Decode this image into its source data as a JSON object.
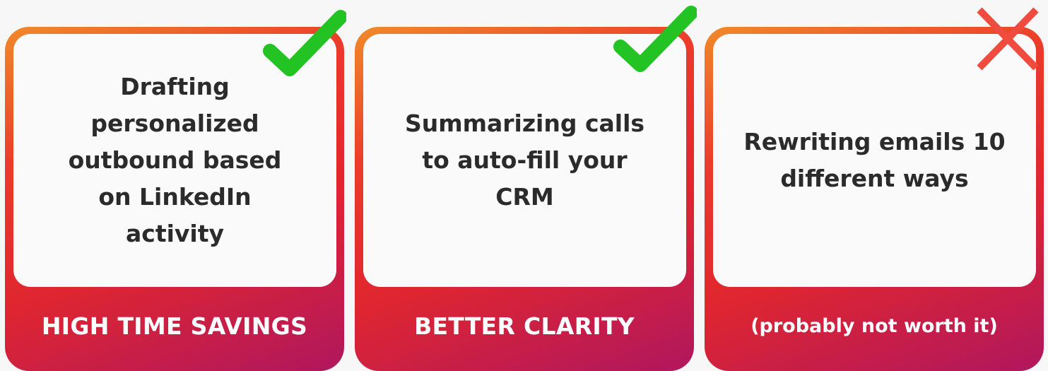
{
  "cards": [
    {
      "text": "Drafting personalized outbound based on LinkedIn activity",
      "label": "HIGH TIME SAVINGS",
      "mark": "check-icon"
    },
    {
      "text": "Summarizing calls to auto-fill your CRM",
      "label": "BETTER CLARITY",
      "mark": "check-icon"
    },
    {
      "text": "Rewriting emails 10 different ways",
      "label": "(probably not worth it)",
      "mark": "cross-icon"
    }
  ],
  "colors": {
    "check": "#22c322",
    "cross": "#ef4b3f",
    "gradient_start": "#f08a2a",
    "gradient_mid": "#e0262f",
    "gradient_end": "#b0175e",
    "card_text": "#2b2b2b",
    "label_text": "#ffffff"
  }
}
